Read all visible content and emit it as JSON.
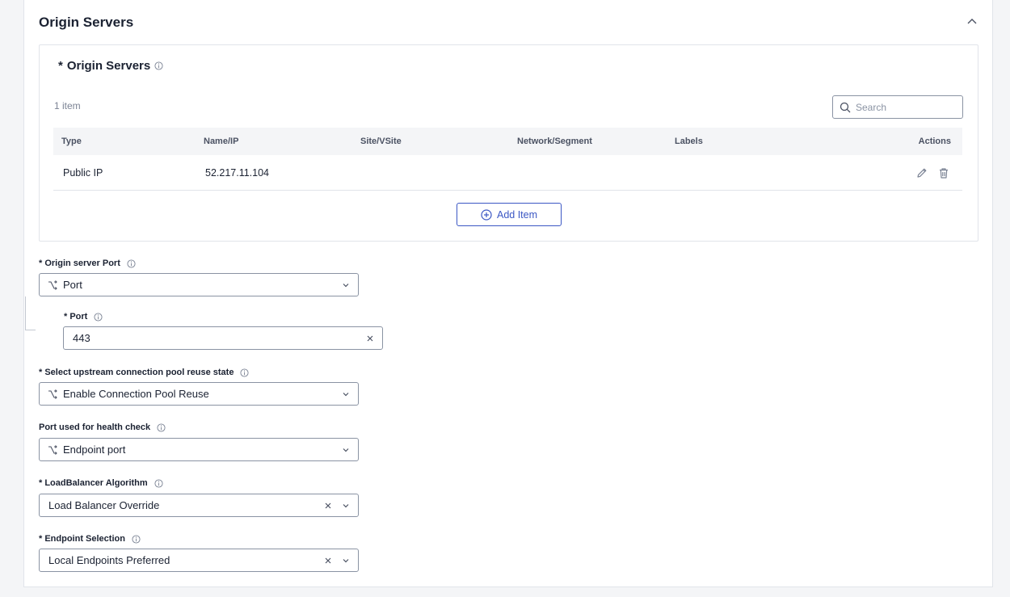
{
  "section": {
    "title": "Origin Servers"
  },
  "origin_servers": {
    "title": "Origin Servers",
    "required_mark": "*",
    "count": "1 item",
    "search_placeholder": "Search",
    "columns": [
      "Type",
      "Name/IP",
      "Site/VSite",
      "Network/Segment",
      "Labels",
      "Actions"
    ],
    "rows": [
      {
        "type": "Public IP",
        "name_ip": "52.217.11.104",
        "site": "",
        "network": "",
        "labels": ""
      }
    ],
    "add_label": "Add Item"
  },
  "fields": {
    "origin_port": {
      "label": "* Origin server Port",
      "value": "Port"
    },
    "port": {
      "label": "* Port",
      "value": "443"
    },
    "pool_reuse": {
      "label": "* Select upstream connection pool reuse state",
      "value": "Enable Connection Pool Reuse"
    },
    "health_port": {
      "label": "Port used for health check",
      "value": "Endpoint port"
    },
    "lb_algo": {
      "label": "* LoadBalancer Algorithm",
      "value": "Load Balancer Override"
    },
    "endpoint_sel": {
      "label": "* Endpoint Selection",
      "value": "Local Endpoints Preferred"
    }
  },
  "colors": {
    "accent": "#3b57c4",
    "border": "#8a93a3",
    "header_bg": "#f4f5f7"
  }
}
